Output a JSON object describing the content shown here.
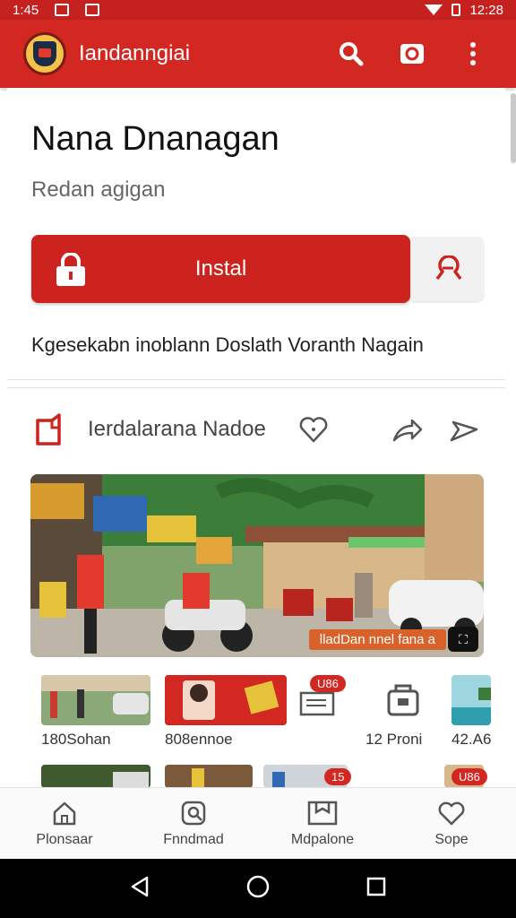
{
  "status_bar": {
    "time_left": "1:45",
    "time_right": "12:28"
  },
  "app_bar": {
    "title": "Iandanngiai"
  },
  "app_card": {
    "name": "Nana Dnanagan",
    "subtitle": "Redan agigan",
    "install_label": "Instal",
    "description": "Kgesekabn inoblann Doslath Voranth Nagain"
  },
  "section": {
    "title": "Ierdalarana Nadoe",
    "hero_caption": "lladDan nnel fana a"
  },
  "tiles": [
    {
      "label": "180Sohan",
      "badge": ""
    },
    {
      "label": "808ennoe",
      "badge": ""
    },
    {
      "label": "",
      "badge": "U86"
    },
    {
      "label": "12 Proni",
      "badge": ""
    },
    {
      "label": "42.A6",
      "badge": ""
    }
  ],
  "row2_badges": [
    "15",
    "U86"
  ],
  "bottom_nav": [
    {
      "label": "Plonsaar"
    },
    {
      "label": "Fnndmad"
    },
    {
      "label": "Mdpalone"
    },
    {
      "label": "Sope"
    }
  ],
  "colors": {
    "brand_red": "#d32722",
    "status_red": "#c4211f"
  }
}
